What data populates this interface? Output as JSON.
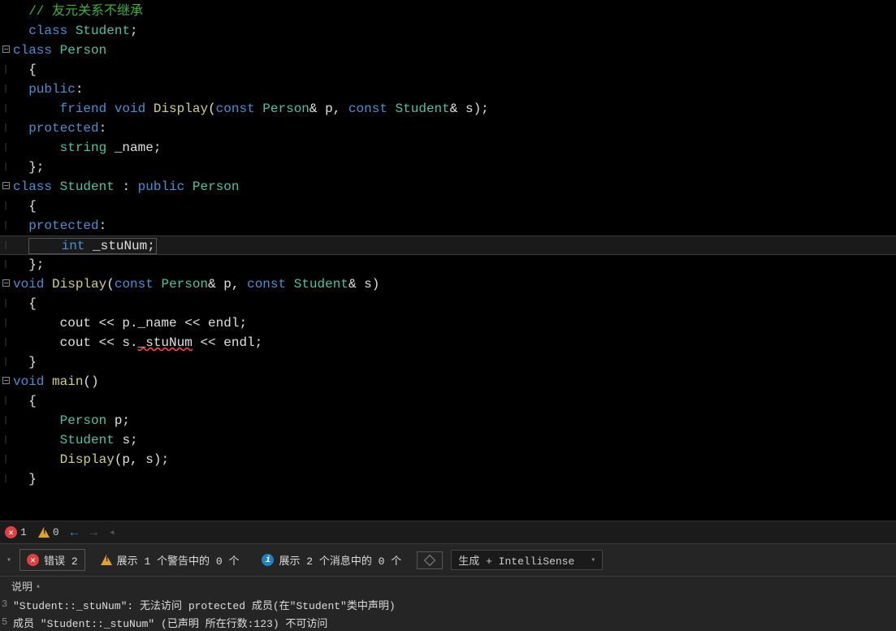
{
  "code": {
    "comment": "// 友元关系不继承",
    "kw_class": "class",
    "type_student": "Student",
    "type_person": "Person",
    "kw_public": "public",
    "kw_protected": "protected",
    "kw_friend": "friend",
    "kw_void": "void",
    "kw_const": "const",
    "kw_int": "int",
    "fn_display": "Display",
    "type_string": "string",
    "field_name": "_name",
    "field_stunum": "_stuNum",
    "var_p": "p",
    "var_s": "s",
    "var_cout": "cout",
    "var_endl": "endl",
    "fn_main": "main"
  },
  "status": {
    "error_count": "1",
    "warn_count": "0"
  },
  "filter": {
    "errors_label": "错误 2",
    "warnings_label": "展示 1 个警告中的 0 个",
    "messages_label": "展示 2 个消息中的 0 个",
    "build_label": "生成 + IntelliSense"
  },
  "errorlist": {
    "header": "说明",
    "row1_badge": "3",
    "row1_text": "\"Student::_stuNum\": 无法访问 protected 成员(在\"Student\"类中声明)",
    "row2_badge": "5",
    "row2_text": "成员 \"Student::_stuNum\" (已声明 所在行数:123) 不可访问"
  }
}
